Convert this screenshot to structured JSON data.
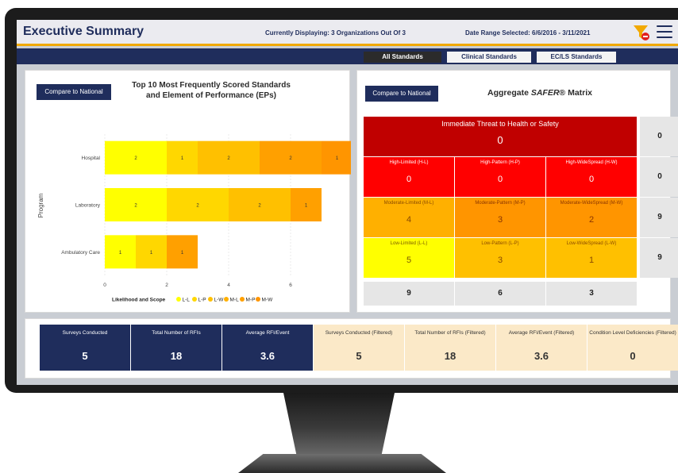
{
  "header": {
    "title": "Executive Summary",
    "display_info": "Currently Displaying: 3 Organizations Out Of 3",
    "date_range": "Date Range Selected: 6/6/2016 - 3/11/2021",
    "filter_icon": "filter-clear-icon",
    "menu_icon": "hamburger-menu-icon"
  },
  "tabs": [
    {
      "label": "All Standards",
      "active": true
    },
    {
      "label": "Clinical Standards",
      "active": false
    },
    {
      "label": "EC/LS Standards",
      "active": false
    }
  ],
  "left_panel": {
    "button_label": "Compare to National",
    "title_line1": "Top 10 Most Frequently Scored Standards",
    "title_line2": "and Element of Performance (EPs)"
  },
  "chart_data": {
    "type": "bar",
    "orientation": "horizontal",
    "stacked": true,
    "categories": [
      "Hospital",
      "Laboratory",
      "Ambulatory Care"
    ],
    "ylabel": "Program",
    "xlabel": "",
    "xlim": [
      0,
      8
    ],
    "xticks": [
      "0",
      "2",
      "4",
      "6",
      "8"
    ],
    "legend_title": "Likelihood and Scope",
    "segments": [
      {
        "category": "Hospital",
        "level": "L-L",
        "value": 2,
        "color": "#ffff00"
      },
      {
        "category": "Hospital",
        "level": "L-P",
        "value": 1,
        "color": "#ffd700"
      },
      {
        "category": "Hospital",
        "level": "L-W",
        "value": 2,
        "color": "#ffc000"
      },
      {
        "category": "Hospital",
        "level": "M-P",
        "value": 2,
        "color": "#ffa000"
      },
      {
        "category": "Hospital",
        "level": "M-W",
        "value": 1,
        "color": "#ff9500"
      },
      {
        "category": "Laboratory",
        "level": "L-L",
        "value": 2,
        "color": "#ffff00"
      },
      {
        "category": "Laboratory",
        "level": "L-P",
        "value": 2,
        "color": "#ffd700"
      },
      {
        "category": "Laboratory",
        "level": "L-W",
        "value": 2,
        "color": "#ffc000"
      },
      {
        "category": "Laboratory",
        "level": "M-L",
        "value": 1,
        "color": "#ffa000"
      },
      {
        "category": "Ambulatory Care",
        "level": "L-L",
        "value": 1,
        "color": "#ffff00"
      },
      {
        "category": "Ambulatory Care",
        "level": "L-P",
        "value": 1,
        "color": "#ffd700"
      },
      {
        "category": "Ambulatory Care",
        "level": "M-L",
        "value": 1,
        "color": "#ffa000"
      }
    ],
    "legend": [
      {
        "label": "L-L",
        "color": "#ffff00"
      },
      {
        "label": "L-P",
        "color": "#ffd700"
      },
      {
        "label": "L-W",
        "color": "#ffc000"
      },
      {
        "label": "M-L",
        "color": "#ffb000"
      },
      {
        "label": "M-P",
        "color": "#ffa000"
      },
      {
        "label": "M-W",
        "color": "#ff9500"
      }
    ]
  },
  "right_panel": {
    "button_label": "Compare to National",
    "title_prefix": "Aggregate ",
    "title_italic": "SAFER",
    "title_suffix": "® Matrix",
    "immediate_threat": {
      "label": "Immediate Threat to Health or Safety",
      "value": "0"
    },
    "rows": [
      {
        "cells": [
          {
            "label": "High-Limited (H-L)",
            "value": "0",
            "color": "#ff0000"
          },
          {
            "label": "High-Pattern (H-P)",
            "value": "0",
            "color": "#ff0000"
          },
          {
            "label": "High-WideSpread (H-W)",
            "value": "0",
            "color": "#ff0000"
          }
        ],
        "total": "0"
      },
      {
        "cells": [
          {
            "label": "Moderate-Limited (M-L)",
            "value": "4",
            "color": "#ffb000"
          },
          {
            "label": "Moderate-Pattern (M-P)",
            "value": "3",
            "color": "#ff9500"
          },
          {
            "label": "Moderate-WideSpread (M-W)",
            "value": "2",
            "color": "#ff9500"
          }
        ],
        "total": "9"
      },
      {
        "cells": [
          {
            "label": "Low-Limited (L-L)",
            "value": "5",
            "color": "#ffff00"
          },
          {
            "label": "Low-Pattern (L-P)",
            "value": "3",
            "color": "#ffc000"
          },
          {
            "label": "Low-WideSpread (L-W)",
            "value": "1",
            "color": "#ffc000"
          }
        ],
        "total": "9"
      }
    ],
    "immediate_total": "0",
    "column_totals": [
      "9",
      "6",
      "3"
    ]
  },
  "kpis": [
    {
      "label": "Surveys Conducted",
      "value": "5",
      "style": "dark"
    },
    {
      "label": "Total Number of RFIs",
      "value": "18",
      "style": "dark"
    },
    {
      "label": "Average RFI/Event",
      "value": "3.6",
      "style": "dark"
    },
    {
      "label": "Surveys Conducted (Filtered)",
      "value": "5",
      "style": "light"
    },
    {
      "label": "Total Number of RFIs (Filtered)",
      "value": "18",
      "style": "light"
    },
    {
      "label": "Average RFI/Event (Filtered)",
      "value": "3.6",
      "style": "light"
    },
    {
      "label": "Condition Level Deficiencies (Filtered)",
      "value": "0",
      "style": "light"
    }
  ]
}
